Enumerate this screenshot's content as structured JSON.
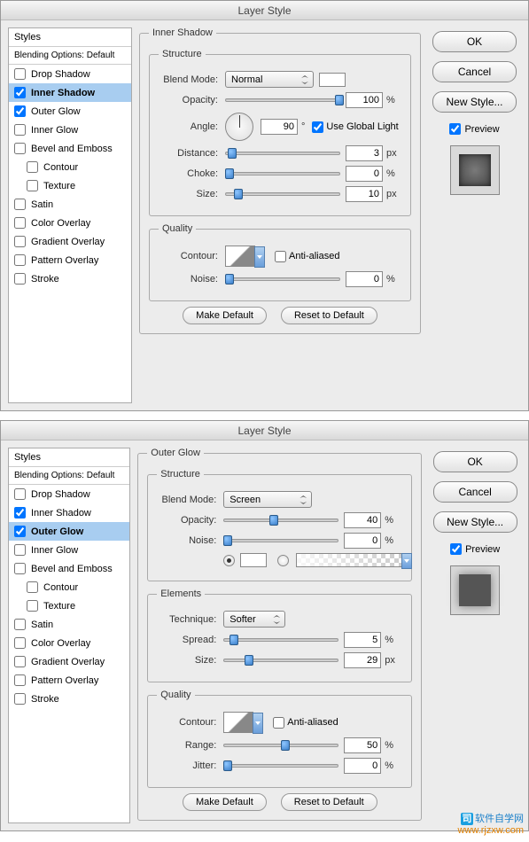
{
  "dialog1": {
    "title": "Layer Style",
    "styles_header": "Styles",
    "styles_sub": "Blending Options: Default",
    "items": [
      {
        "label": "Drop Shadow",
        "checked": false,
        "selected": false
      },
      {
        "label": "Inner Shadow",
        "checked": true,
        "selected": true
      },
      {
        "label": "Outer Glow",
        "checked": true,
        "selected": false
      },
      {
        "label": "Inner Glow",
        "checked": false,
        "selected": false
      },
      {
        "label": "Bevel and Emboss",
        "checked": false,
        "selected": false
      },
      {
        "label": "Contour",
        "checked": false,
        "selected": false,
        "indent": true
      },
      {
        "label": "Texture",
        "checked": false,
        "selected": false,
        "indent": true
      },
      {
        "label": "Satin",
        "checked": false,
        "selected": false
      },
      {
        "label": "Color Overlay",
        "checked": false,
        "selected": false
      },
      {
        "label": "Gradient Overlay",
        "checked": false,
        "selected": false
      },
      {
        "label": "Pattern Overlay",
        "checked": false,
        "selected": false
      },
      {
        "label": "Stroke",
        "checked": false,
        "selected": false
      }
    ],
    "panel_title": "Inner Shadow",
    "structure_legend": "Structure",
    "blend_mode_label": "Blend Mode:",
    "blend_mode_value": "Normal",
    "opacity_label": "Opacity:",
    "opacity_value": "100",
    "angle_label": "Angle:",
    "angle_value": "90",
    "angle_unit": "°",
    "global_light_label": "Use Global Light",
    "distance_label": "Distance:",
    "distance_value": "3",
    "distance_unit": "px",
    "choke_label": "Choke:",
    "choke_value": "0",
    "size_label": "Size:",
    "size_value": "10",
    "size_unit": "px",
    "quality_legend": "Quality",
    "contour_label": "Contour:",
    "anti_aliased_label": "Anti-aliased",
    "noise_label": "Noise:",
    "noise_value": "0",
    "make_default": "Make Default",
    "reset_default": "Reset to Default"
  },
  "dialog2": {
    "title": "Layer Style",
    "styles_header": "Styles",
    "styles_sub": "Blending Options: Default",
    "items": [
      {
        "label": "Drop Shadow",
        "checked": false,
        "selected": false
      },
      {
        "label": "Inner Shadow",
        "checked": true,
        "selected": false
      },
      {
        "label": "Outer Glow",
        "checked": true,
        "selected": true
      },
      {
        "label": "Inner Glow",
        "checked": false,
        "selected": false
      },
      {
        "label": "Bevel and Emboss",
        "checked": false,
        "selected": false
      },
      {
        "label": "Contour",
        "checked": false,
        "selected": false,
        "indent": true
      },
      {
        "label": "Texture",
        "checked": false,
        "selected": false,
        "indent": true
      },
      {
        "label": "Satin",
        "checked": false,
        "selected": false
      },
      {
        "label": "Color Overlay",
        "checked": false,
        "selected": false
      },
      {
        "label": "Gradient Overlay",
        "checked": false,
        "selected": false
      },
      {
        "label": "Pattern Overlay",
        "checked": false,
        "selected": false
      },
      {
        "label": "Stroke",
        "checked": false,
        "selected": false
      }
    ],
    "panel_title": "Outer Glow",
    "structure_legend": "Structure",
    "blend_mode_label": "Blend Mode:",
    "blend_mode_value": "Screen",
    "opacity_label": "Opacity:",
    "opacity_value": "40",
    "noise_label": "Noise:",
    "noise_value": "0",
    "elements_legend": "Elements",
    "technique_label": "Technique:",
    "technique_value": "Softer",
    "spread_label": "Spread:",
    "spread_value": "5",
    "size_label": "Size:",
    "size_value": "29",
    "size_unit": "px",
    "quality_legend": "Quality",
    "contour_label": "Contour:",
    "anti_aliased_label": "Anti-aliased",
    "range_label": "Range:",
    "range_value": "50",
    "jitter_label": "Jitter:",
    "jitter_value": "0",
    "make_default": "Make Default",
    "reset_default": "Reset to Default"
  },
  "buttons": {
    "ok": "OK",
    "cancel": "Cancel",
    "new_style": "New Style...",
    "preview": "Preview"
  },
  "percent": "%",
  "watermark_site": "www.rjzxw.com",
  "watermark_text": "软件自学网"
}
